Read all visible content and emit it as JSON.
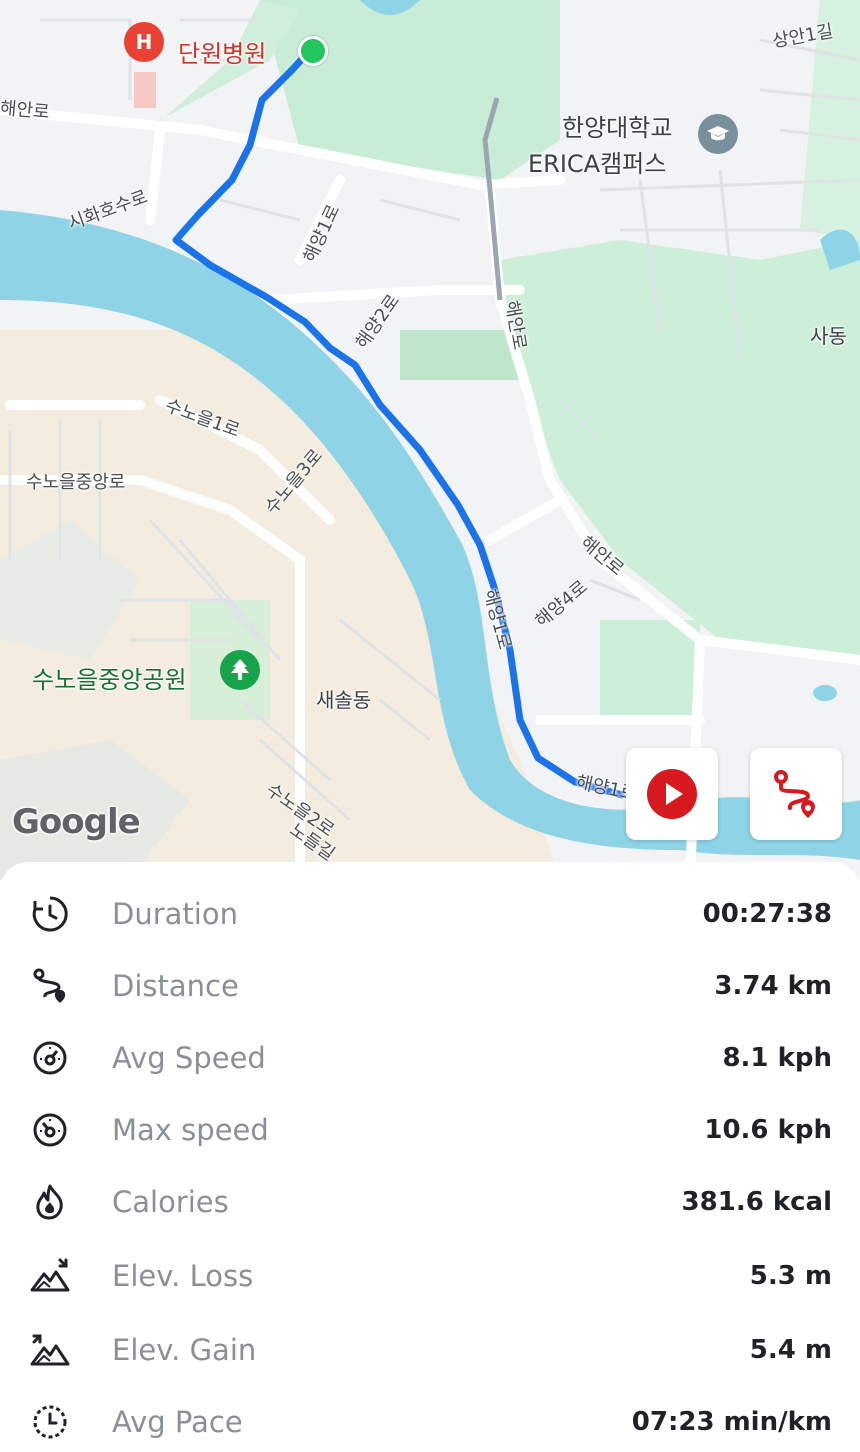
{
  "map": {
    "labels": {
      "hospital": "단원병원",
      "haean_ro_left": "해안로",
      "sihwaho_su_ro": "시화호수로",
      "haeyang_1_ro_top": "해양1로",
      "haeyang_2_ro": "해양2로",
      "haean_ro_mid": "해안로",
      "university_line1": "한양대학교",
      "university_line2": "ERICA캠퍼스",
      "sangan_1_gil": "상안1길",
      "sa_dong": "사동",
      "sunoeul_1_ro": "수노을1로",
      "sunoeul_3_ro": "수노을3로",
      "sunoeul_jungang_ro": "수노을중앙로",
      "haean_ro_right": "해안로",
      "haeyang_4_ro": "해양4로",
      "haeyang_1_ro_mid": "해양1로",
      "park": "수노을중앙공원",
      "saesol_dong": "새솔동",
      "sunoeul_2_ro": "수노을2로",
      "nodeul_gil": "노들길",
      "haeyang_1_ro_bottom": "해양1로"
    },
    "hospital_icon_glyph": "H",
    "google_logo": "Google",
    "route_color": "#1a73e8",
    "start_marker_color": "#22c55e",
    "play_button_icon": "play-icon",
    "route_button_icon": "route-icon"
  },
  "stats": {
    "rows": [
      {
        "icon": "duration-clock-icon",
        "label": "Duration",
        "value": "00:27:38"
      },
      {
        "icon": "distance-route-icon",
        "label": "Distance",
        "value": "3.74 km"
      },
      {
        "icon": "avg-speed-gauge-icon",
        "label": "Avg Speed",
        "value": "8.1 kph"
      },
      {
        "icon": "max-speed-gauge-icon",
        "label": "Max speed",
        "value": "10.6 kph"
      },
      {
        "icon": "calories-flame-icon",
        "label": "Calories",
        "value": "381.6 kcal"
      },
      {
        "icon": "elev-loss-icon",
        "label": "Elev. Loss",
        "value": "5.3 m"
      },
      {
        "icon": "elev-gain-icon",
        "label": "Elev. Gain",
        "value": "5.4 m"
      },
      {
        "icon": "avg-pace-clock-icon",
        "label": "Avg Pace",
        "value": "07:23 min/km"
      }
    ]
  }
}
